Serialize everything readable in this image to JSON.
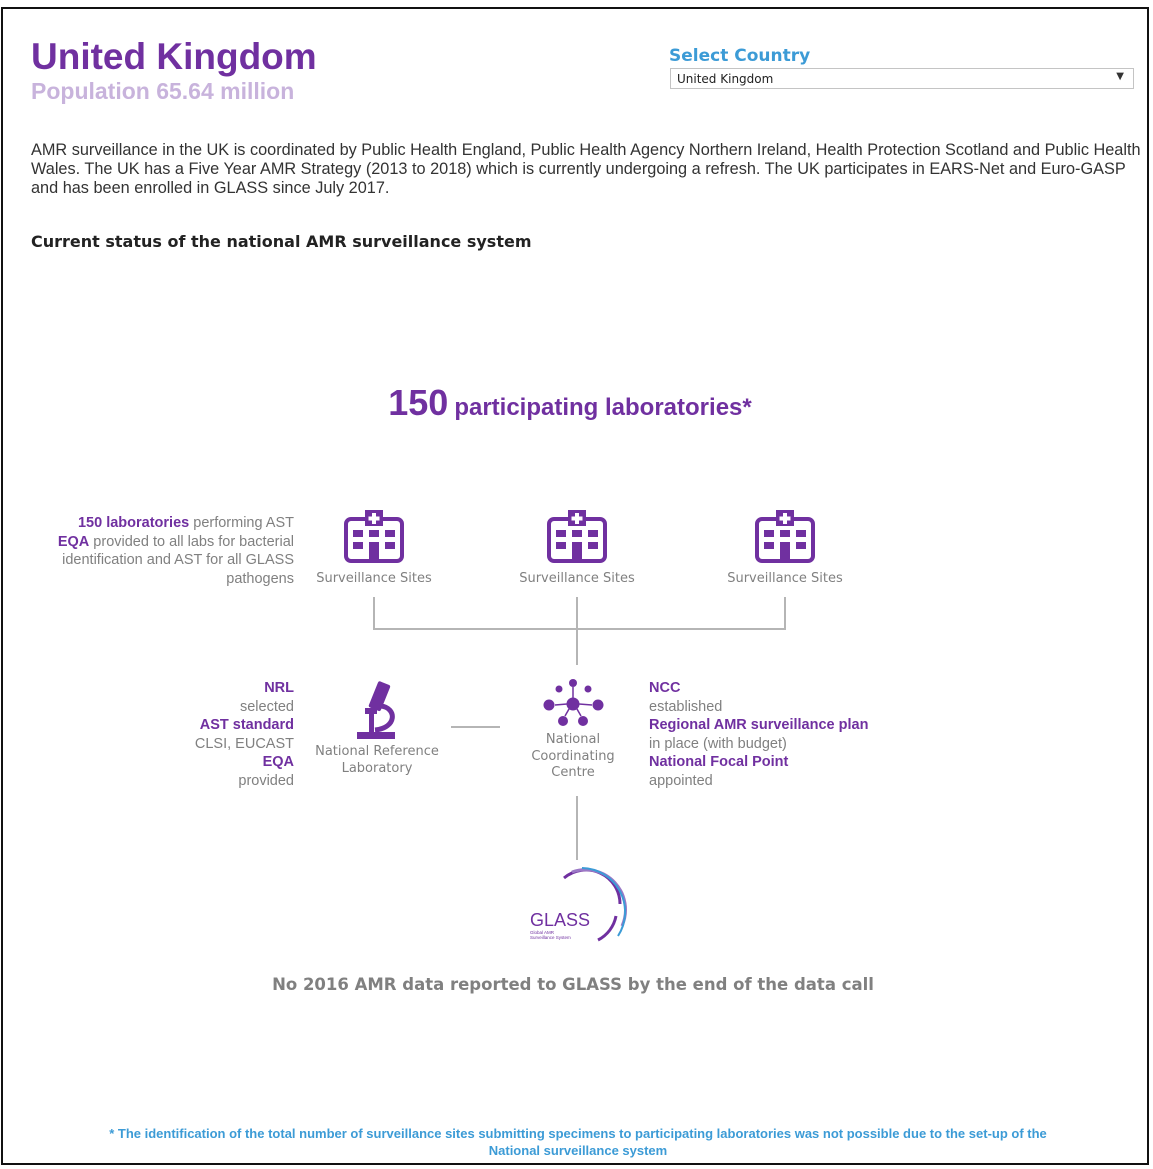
{
  "country": {
    "name": "United Kingdom",
    "population": "Population 65.64 million"
  },
  "selector": {
    "label": "Select Country",
    "selected": "United Kingdom",
    "arrow": "▼"
  },
  "intro_text": "AMR surveillance in the UK is coordinated by Public Health England, Public Health Agency Northern Ireland, Health Protection Scotland and Public Health Wales. The UK has a Five Year AMR Strategy (2013 to 2018) which is currently undergoing a refresh. The UK participates in EARS-Net and Euro-GASP and has been enrolled in GLASS since July 2017.",
  "status_heading": "Current status of the national AMR surveillance system",
  "labs": {
    "count": "150",
    "label": "participating laboratories*"
  },
  "labs_info": {
    "count_bold": "150 laboratories",
    "count_rest": "performing AST",
    "eqa_bold": "EQA",
    "eqa_rest_1": "provided to all labs for bacterial",
    "eqa_rest_2": "identification and AST for all GLASS",
    "eqa_rest_3": "pathogens"
  },
  "sites": [
    {
      "label": "Surveillance Sites"
    },
    {
      "label": "Surveillance Sites"
    },
    {
      "label": "Surveillance Sites"
    }
  ],
  "nrl": {
    "items": [
      {
        "bold": "NRL",
        "text": "selected"
      },
      {
        "bold": "AST standard",
        "text": "CLSI, EUCAST"
      },
      {
        "bold": "EQA",
        "text": "provided"
      }
    ],
    "label_1": "National Reference",
    "label_2": "Laboratory"
  },
  "ncc": {
    "items": [
      {
        "bold": "NCC",
        "text": "established"
      },
      {
        "bold": "Regional AMR surveillance plan",
        "text": "in place (with budget)"
      },
      {
        "bold": "National Focal Point",
        "text": "appointed"
      }
    ],
    "label_1": "National",
    "label_2": "Coordinating",
    "label_3": "Centre"
  },
  "glass": {
    "logo_text": "GLASS",
    "logo_sub_1": "Global AMR",
    "logo_sub_2": "Surveillance System"
  },
  "no_data_text": "No 2016 AMR data reported to GLASS by the end of the data call",
  "footnote_line1": "* The identification of the total number of surveillance sites submitting specimens to participating laboratories was not possible due to the set-up of the",
  "footnote_line2": "National surveillance system",
  "colors": {
    "accent_purple": "#7030a0",
    "light_purple": "#c8b3dc",
    "link_blue": "#3c9bd6",
    "muted_gray": "#808080"
  },
  "icons": [
    "hospital-icon",
    "microscope-icon",
    "network-icon",
    "glass-logo"
  ]
}
